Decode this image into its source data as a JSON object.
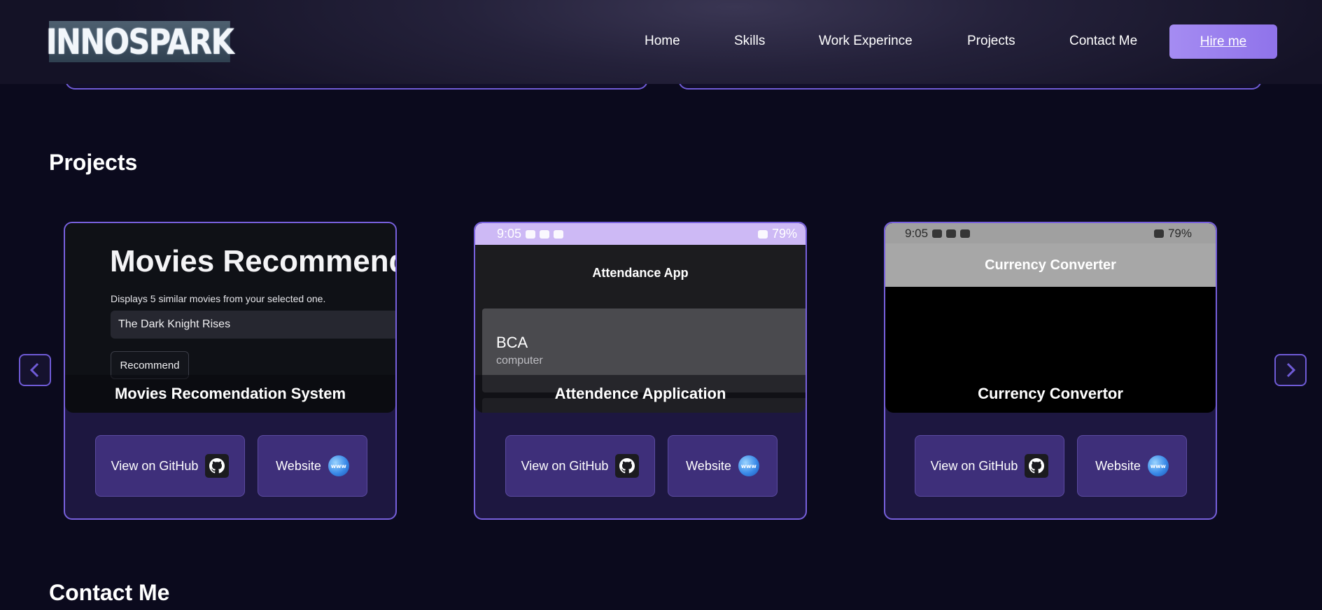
{
  "brand": {
    "logo_text": "INNOSPARK"
  },
  "nav": {
    "items": [
      "Home",
      "Skills",
      "Work Experince",
      "Projects",
      "Contact Me"
    ],
    "hire_label": "Hire me"
  },
  "projects_section": {
    "title": "Projects",
    "cards": [
      {
        "caption": "Movies Recomendation System",
        "github_label": "View on GitHub",
        "website_label": "Website",
        "preview": {
          "heading": "Movies Recommenda",
          "subtitle": "Displays 5 similar movies from your selected one.",
          "input_value": "The Dark Knight Rises",
          "button_label": "Recommend"
        }
      },
      {
        "caption": "Attendence Application",
        "github_label": "View on GitHub",
        "website_label": "Website",
        "preview": {
          "status_time": "9:05",
          "status_battery": "79%",
          "app_title": "Attendance App",
          "item_title": "BCA",
          "item_subtitle": "computer"
        }
      },
      {
        "caption": "Currency Convertor",
        "github_label": "View on GitHub",
        "website_label": "Website",
        "preview": {
          "status_time": "9:05",
          "status_battery": "79%",
          "app_title": "Currency Converter"
        }
      }
    ]
  },
  "contact_section": {
    "title": "Contact Me"
  },
  "icons": {
    "prev": "chevron-left-icon",
    "next": "chevron-right-icon",
    "github": "github-icon",
    "website": "globe-www-icon",
    "globe_text": "www"
  },
  "colors": {
    "background": "#0b0a1d",
    "card": "#1d1740",
    "card_border": "#7760dc",
    "button": "#3e2f7a",
    "accent": "#9b80f0"
  }
}
